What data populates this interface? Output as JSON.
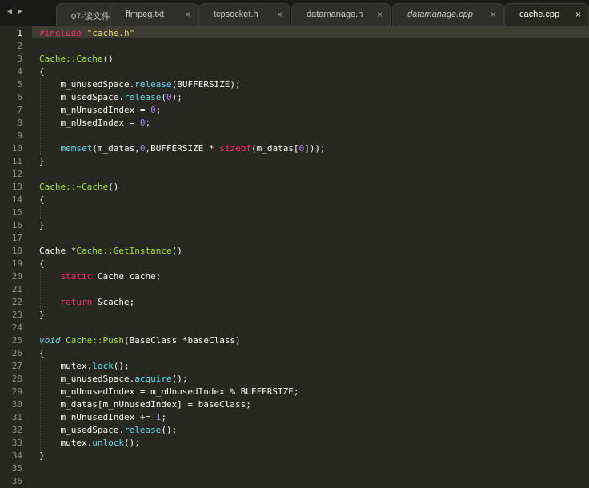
{
  "tabs": [
    {
      "label": "07-读文件f",
      "active": false,
      "italic": false
    },
    {
      "label": "ffmpeg.txt",
      "active": false,
      "italic": false
    },
    {
      "label": "tcpsocket.h",
      "active": false,
      "italic": false
    },
    {
      "label": "datamanage.h",
      "active": false,
      "italic": false
    },
    {
      "label": "datamanage.cpp",
      "active": false,
      "italic": true
    },
    {
      "label": "cache.cpp",
      "active": true,
      "italic": false
    }
  ],
  "nav": {
    "back_icon": "◀",
    "forward_icon": "▶",
    "close_icon": "×"
  },
  "editor": {
    "current_line": 1,
    "lines": [
      [
        [
          "#include ",
          "kw-pre"
        ],
        [
          "\"cache.h\"",
          "str"
        ]
      ],
      [],
      [
        [
          "Cache::Cache",
          "cls"
        ],
        [
          "()",
          ""
        ]
      ],
      [
        [
          "{",
          ""
        ]
      ],
      [
        [
          "    m_unusedSpace.",
          ""
        ],
        [
          "release",
          "fn"
        ],
        [
          "(BUFFERSIZE);",
          ""
        ]
      ],
      [
        [
          "    m_usedSpace.",
          ""
        ],
        [
          "release",
          "fn"
        ],
        [
          "(",
          ""
        ],
        [
          "0",
          "num"
        ],
        [
          ");",
          ""
        ]
      ],
      [
        [
          "    m_nUnusedIndex = ",
          ""
        ],
        [
          "0",
          "num"
        ],
        [
          ";",
          ""
        ]
      ],
      [
        [
          "    m_nUsedIndex = ",
          ""
        ],
        [
          "0",
          "num"
        ],
        [
          ";",
          ""
        ]
      ],
      [],
      [
        [
          "    ",
          ""
        ],
        [
          "memset",
          "fn"
        ],
        [
          "(m_datas,",
          ""
        ],
        [
          "0",
          "num"
        ],
        [
          ",BUFFERSIZE * ",
          ""
        ],
        [
          "sizeof",
          "kw"
        ],
        [
          "(m_datas[",
          ""
        ],
        [
          "0",
          "num"
        ],
        [
          "]));",
          ""
        ]
      ],
      [
        [
          "}",
          ""
        ]
      ],
      [],
      [
        [
          "Cache::~Cache",
          "cls"
        ],
        [
          "()",
          ""
        ]
      ],
      [
        [
          "{",
          ""
        ]
      ],
      [],
      [
        [
          "}",
          ""
        ]
      ],
      [],
      [
        [
          "Cache *",
          ""
        ],
        [
          "Cache::GetInstance",
          "cls"
        ],
        [
          "()",
          ""
        ]
      ],
      [
        [
          "{",
          ""
        ]
      ],
      [
        [
          "    ",
          ""
        ],
        [
          "static",
          "kw"
        ],
        [
          " Cache cache;",
          ""
        ]
      ],
      [],
      [
        [
          "    ",
          ""
        ],
        [
          "return",
          "kw"
        ],
        [
          " &cache;",
          ""
        ]
      ],
      [
        [
          "}",
          ""
        ]
      ],
      [],
      [
        [
          "void",
          "type"
        ],
        [
          " ",
          ""
        ],
        [
          "Cache::Push",
          "cls"
        ],
        [
          "(BaseClass *baseClass)",
          ""
        ]
      ],
      [
        [
          "{",
          ""
        ]
      ],
      [
        [
          "    mutex.",
          ""
        ],
        [
          "lock",
          "fn"
        ],
        [
          "();",
          ""
        ]
      ],
      [
        [
          "    m_unusedSpace.",
          ""
        ],
        [
          "acquire",
          "fn"
        ],
        [
          "();",
          ""
        ]
      ],
      [
        [
          "    m_nUnusedIndex = m_nUnusedIndex % BUFFERSIZE;",
          ""
        ]
      ],
      [
        [
          "    m_datas[m_nUnusedIndex] = baseClass;",
          ""
        ]
      ],
      [
        [
          "    m_nUnusedIndex += ",
          ""
        ],
        [
          "1",
          "num"
        ],
        [
          ";",
          ""
        ]
      ],
      [
        [
          "    m_usedSpace.",
          ""
        ],
        [
          "release",
          "fn"
        ],
        [
          "();",
          ""
        ]
      ],
      [
        [
          "    mutex.",
          ""
        ],
        [
          "unlock",
          "fn"
        ],
        [
          "();",
          ""
        ]
      ],
      [
        [
          "}",
          ""
        ]
      ],
      [],
      []
    ]
  }
}
